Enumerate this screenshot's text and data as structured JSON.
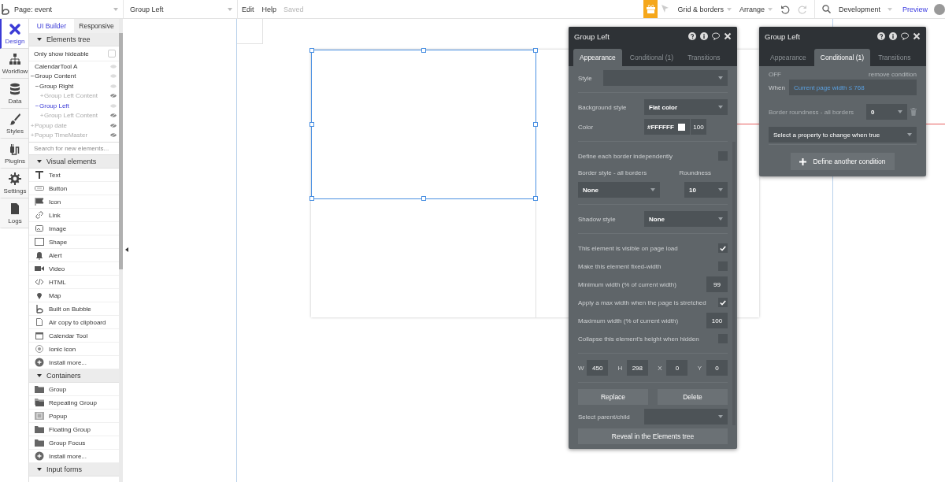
{
  "top_bar": {
    "page_selector": "Page: event",
    "element_selector": "Group Left",
    "menu": [
      {
        "label": "Edit"
      },
      {
        "label": "Help"
      }
    ],
    "save_status": "Saved",
    "tools": [
      {
        "label": "Grid & borders"
      },
      {
        "label": "Arrange"
      }
    ],
    "environment": "Development",
    "preview": "Preview"
  },
  "nav": [
    {
      "label": "Design",
      "selected": true
    },
    {
      "label": "Workflow",
      "selected": false
    },
    {
      "label": "Data",
      "selected": false
    },
    {
      "label": "Styles",
      "selected": false
    },
    {
      "label": "Plugins",
      "selected": false
    },
    {
      "label": "Settings",
      "selected": false
    },
    {
      "label": "Logs",
      "selected": false
    }
  ],
  "side_panel": {
    "tabs": [
      {
        "label": "UI Builder",
        "selected": true
      },
      {
        "label": "Responsive",
        "selected": false
      }
    ],
    "elements_tree": {
      "title": "Elements tree",
      "expanded": true,
      "filter_label": "Only show hideable",
      "filter_checked": false,
      "items": [
        {
          "label": "CalendarTool A",
          "selected": false,
          "hidden": false
        },
        {
          "label": "Group Content",
          "toggle": "−",
          "selected": false,
          "hidden": false,
          "children": [
            {
              "label": "Group Right",
              "toggle": "−",
              "selected": false,
              "hidden": false,
              "children": [
                {
                  "label": "Group Left Content",
                  "toggle": "+",
                  "selected": false,
                  "hidden": true
                }
              ]
            },
            {
              "label": "Group Left",
              "toggle": "−",
              "selected": true,
              "hidden": false,
              "children": [
                {
                  "label": "Group Left Content",
                  "toggle": "+",
                  "selected": false,
                  "hidden": true
                }
              ]
            }
          ]
        },
        {
          "label": "Popup date",
          "toggle": "+",
          "selected": false,
          "hidden": true
        },
        {
          "label": "Popup TimeMaster",
          "toggle": "+",
          "selected": false,
          "hidden": true
        }
      ]
    },
    "search": {
      "placeholder": "Search for new elements..."
    },
    "sections": [
      {
        "title": "Visual elements",
        "expanded": true,
        "items": [
          {
            "label": "Text",
            "kind": "text"
          },
          {
            "label": "Button",
            "kind": "button"
          },
          {
            "label": "Icon",
            "kind": "icon"
          },
          {
            "label": "Link",
            "kind": "link"
          },
          {
            "label": "Image",
            "kind": "image"
          },
          {
            "label": "Shape",
            "kind": "shape"
          },
          {
            "label": "Alert",
            "kind": "alert"
          },
          {
            "label": "Video",
            "kind": "video"
          },
          {
            "label": "HTML",
            "kind": "html"
          },
          {
            "label": "Map",
            "kind": "map"
          },
          {
            "label": "Built on Bubble",
            "kind": "logo"
          },
          {
            "label": "Air copy to clipboard",
            "kind": "document"
          },
          {
            "label": "Calendar Tool",
            "kind": "calendar"
          },
          {
            "label": "Ionic Icon",
            "kind": "radio"
          },
          {
            "label": "Install more...",
            "kind": "install"
          }
        ]
      },
      {
        "title": "Containers",
        "expanded": true,
        "items": [
          {
            "label": "Group",
            "kind": "folder"
          },
          {
            "label": "Repeating Group",
            "kind": "folders"
          },
          {
            "label": "Popup",
            "kind": "window"
          },
          {
            "label": "Floating Group",
            "kind": "folder"
          },
          {
            "label": "Group Focus",
            "kind": "folder"
          },
          {
            "label": "Install more...",
            "kind": "install"
          }
        ]
      },
      {
        "title": "Input forms",
        "expanded": true
      }
    ]
  },
  "editors": [
    {
      "title": "Group Left",
      "tabs": [
        {
          "label": "Appearance",
          "selected": true
        },
        {
          "label": "Conditional (1)",
          "selected": false
        },
        {
          "label": "Transitions",
          "selected": false
        }
      ],
      "sections": [
        [
          {
            "kind": "style",
            "label": "Style"
          }
        ],
        [
          {
            "kind": "select",
            "label": "Background style",
            "value": "Flat color"
          },
          {
            "kind": "color",
            "label": "Color",
            "value": "#FFFFFF",
            "opacity": "100"
          }
        ],
        [
          {
            "kind": "checkbox",
            "label": "Define each border independently",
            "checked": false
          },
          {
            "kind": "border",
            "label": "Border style - all borders",
            "value": "None",
            "roundness_label": "Roundness",
            "roundness": "10"
          }
        ],
        [
          {
            "kind": "select",
            "label": "Shadow style",
            "value": "None"
          }
        ],
        [
          {
            "kind": "checkbox",
            "label": "This element is visible on page load",
            "checked": true
          },
          {
            "kind": "checkbox",
            "label": "Make this element fixed-width",
            "checked": false
          },
          {
            "kind": "number",
            "label": "Minimum width (% of current width)",
            "value": "99"
          },
          {
            "kind": "checkbox",
            "label": "Apply a max width when the page is stretched",
            "checked": true
          },
          {
            "kind": "number",
            "label": "Maximum width (% of current width)",
            "value": "100"
          },
          {
            "kind": "checkbox",
            "label": "Collapse this element's height when hidden",
            "checked": false
          }
        ],
        [
          {
            "kind": "geometry",
            "fields": [
              {
                "label": "W",
                "value": "450"
              },
              {
                "label": "H",
                "value": "298"
              },
              {
                "label": "X",
                "value": "0"
              },
              {
                "label": "Y",
                "value": "0"
              }
            ]
          }
        ],
        [
          {
            "kind": "buttons",
            "buttons": [
              "Replace",
              "Delete"
            ]
          },
          {
            "kind": "select",
            "label": "Select parent/child"
          },
          {
            "kind": "wide_button",
            "label": "Reveal in the Elements tree"
          }
        ]
      ]
    },
    {
      "title": "Group Left",
      "tabs": [
        {
          "label": "Appearance",
          "selected": false
        },
        {
          "label": "Conditional (1)",
          "selected": true
        },
        {
          "label": "Transitions",
          "selected": false
        }
      ],
      "condition": {
        "state": "OFF",
        "remove_label": "remove condition",
        "when_label": "When",
        "expression": "Current page width ≤ 768",
        "property": {
          "label": "Border roundness - all borders",
          "value": "0"
        },
        "add_property_placeholder": "Select a property to change when true",
        "add_condition": "Define another condition"
      }
    }
  ]
}
